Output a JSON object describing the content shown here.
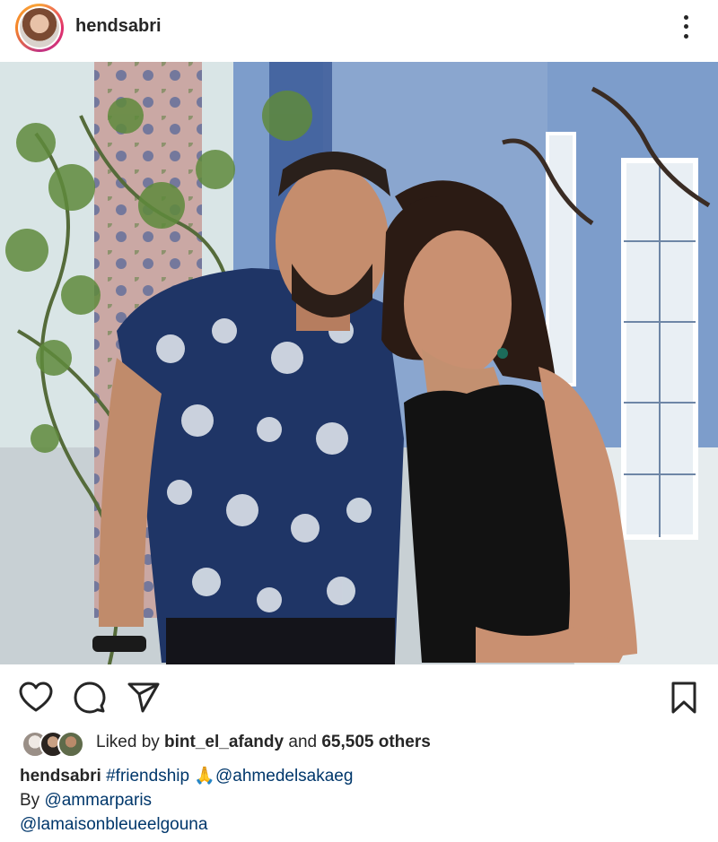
{
  "post": {
    "username": "hendsabri",
    "more_icon": "more-vertical-icon"
  },
  "actions": {
    "like_icon": "heart-icon",
    "comment_icon": "comment-icon",
    "share_icon": "send-icon",
    "save_icon": "bookmark-icon"
  },
  "likes": {
    "prefix": "Liked by ",
    "first_liker": "bint_el_afandy",
    "middle": " and ",
    "others_count": "65,505 others"
  },
  "caption": {
    "username": "hendsabri",
    "hashtag": "#friendship",
    "emoji": "🙏",
    "mention1": "@ahmedelsakaeg",
    "line2_prefix": "By ",
    "mention2": "@ammarparis",
    "mention3": "@lamaisonbleueelgouna"
  },
  "colors": {
    "text": "#262626",
    "link": "#00376b"
  }
}
